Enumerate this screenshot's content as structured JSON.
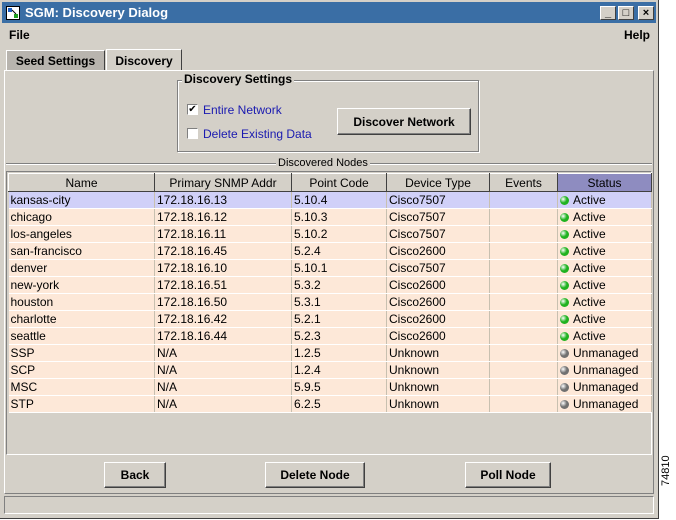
{
  "window": {
    "title": "SGM: Discovery Dialog",
    "min_glyph": "_",
    "max_glyph": "□",
    "close_glyph": "×"
  },
  "menu": {
    "file": "File",
    "help": "Help"
  },
  "tabs": [
    {
      "label": "Seed Settings",
      "active": false
    },
    {
      "label": "Discovery",
      "active": true
    }
  ],
  "discovery_settings": {
    "title": "Discovery Settings",
    "entire_network": {
      "label": "Entire Network",
      "checked": true,
      "mark": "✔"
    },
    "delete_existing": {
      "label": "Delete Existing Data",
      "checked": false,
      "mark": ""
    },
    "discover_button": "Discover Network"
  },
  "nodes": {
    "title": "Discovered Nodes",
    "columns": [
      "Name",
      "Primary SNMP Addr",
      "Point Code",
      "Device Type",
      "Events",
      "Status"
    ],
    "sorted_column": "Status",
    "rows": [
      {
        "name": "kansas-city",
        "addr": "172.18.16.13",
        "pc": "5.10.4",
        "type": "Cisco7507",
        "events": "",
        "status": "Active",
        "selected": true
      },
      {
        "name": "chicago",
        "addr": "172.18.16.12",
        "pc": "5.10.3",
        "type": "Cisco7507",
        "events": "",
        "status": "Active"
      },
      {
        "name": "los-angeles",
        "addr": "172.18.16.11",
        "pc": "5.10.2",
        "type": "Cisco7507",
        "events": "",
        "status": "Active"
      },
      {
        "name": "san-francisco",
        "addr": "172.18.16.45",
        "pc": "5.2.4",
        "type": "Cisco2600",
        "events": "",
        "status": "Active"
      },
      {
        "name": "denver",
        "addr": "172.18.16.10",
        "pc": "5.10.1",
        "type": "Cisco7507",
        "events": "",
        "status": "Active"
      },
      {
        "name": "new-york",
        "addr": "172.18.16.51",
        "pc": "5.3.2",
        "type": "Cisco2600",
        "events": "",
        "status": "Active"
      },
      {
        "name": "houston",
        "addr": "172.18.16.50",
        "pc": "5.3.1",
        "type": "Cisco2600",
        "events": "",
        "status": "Active"
      },
      {
        "name": "charlotte",
        "addr": "172.18.16.42",
        "pc": "5.2.1",
        "type": "Cisco2600",
        "events": "",
        "status": "Active"
      },
      {
        "name": "seattle",
        "addr": "172.18.16.44",
        "pc": "5.2.3",
        "type": "Cisco2600",
        "events": "",
        "status": "Active"
      },
      {
        "name": "SSP",
        "addr": "N/A",
        "pc": "1.2.5",
        "type": "Unknown",
        "events": "",
        "status": "Unmanaged"
      },
      {
        "name": "SCP",
        "addr": "N/A",
        "pc": "1.2.4",
        "type": "Unknown",
        "events": "",
        "status": "Unmanaged"
      },
      {
        "name": "MSC",
        "addr": "N/A",
        "pc": "5.9.5",
        "type": "Unknown",
        "events": "",
        "status": "Unmanaged"
      },
      {
        "name": "STP",
        "addr": "N/A",
        "pc": "6.2.5",
        "type": "Unknown",
        "events": "",
        "status": "Unmanaged"
      }
    ],
    "status_colors": {
      "Active": "#1fb21f",
      "Unmanaged": "#707070"
    }
  },
  "buttons": {
    "back": "Back",
    "delete": "Delete Node",
    "poll": "Poll Node"
  },
  "figure_id": "74810",
  "colors": {
    "title_bar": "#3a6ea5",
    "row_bg": "#fde8d8",
    "selected_row_bg": "#d0d0f8",
    "sorted_header": "#8e8cc0",
    "checkbox_label": "#1a1ab0"
  }
}
